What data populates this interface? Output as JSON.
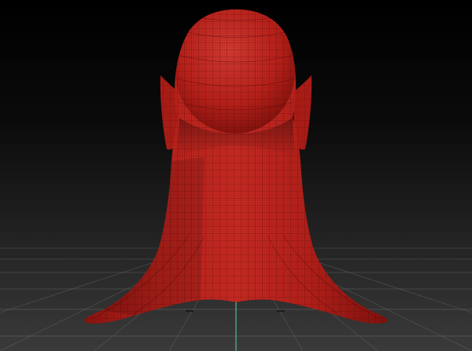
{
  "viewport": {
    "name": "3d-sculpt-viewport",
    "background_top": "#000000",
    "background_bottom": "#3a3a3a",
    "grid_visible": true,
    "grid_color": "#6c6c6c",
    "axis_color": "#57b59b"
  },
  "model": {
    "name": "sculpt-mesh",
    "material_color": "#b8211c",
    "shadow_color": "#6a0d0b",
    "highlight_color": "#d9493f",
    "wireframe_visible": true,
    "wireframe_color": "#4a0706"
  }
}
